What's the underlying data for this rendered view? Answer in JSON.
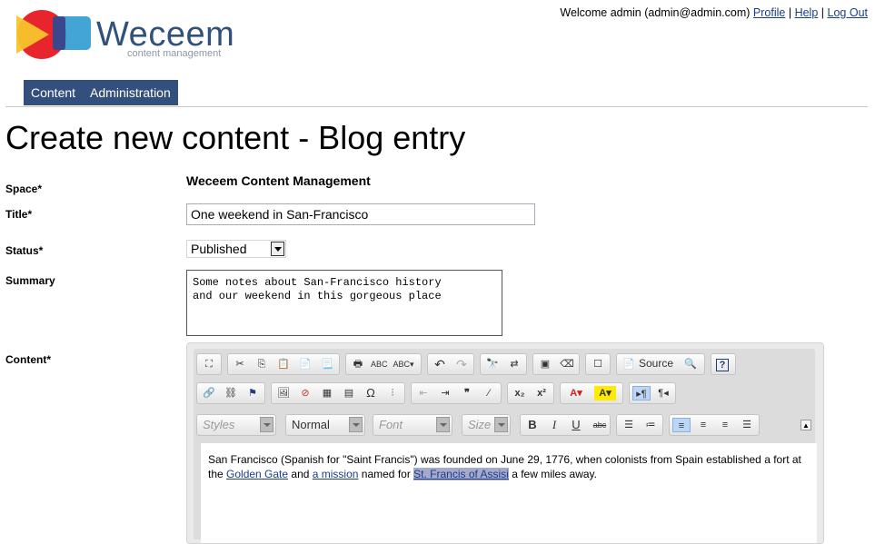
{
  "logo": {
    "name": "Weceem",
    "tagline": "content management"
  },
  "topbar": {
    "welcome": "Welcome admin (admin@admin.com)",
    "profile": "Profile",
    "help": "Help",
    "logout": "Log Out",
    "sep": "|"
  },
  "nav": {
    "tabs": [
      "Content",
      "Administration"
    ]
  },
  "page": {
    "title": "Create new content - Blog entry"
  },
  "form": {
    "space_label": "Space*",
    "space_value": "Weceem Content Management",
    "title_label": "Title*",
    "title_value": "One weekend in San-Francisco",
    "status_label": "Status*",
    "status_value": "Published",
    "summary_label": "Summary",
    "summary_value": "Some notes about San-Francisco history\nand our weekend in this gorgeous place",
    "content_label": "Content*"
  },
  "editor": {
    "source_label": "Source",
    "styles": "Styles",
    "format": "Normal",
    "font": "Font",
    "size": "Size",
    "text_1": "San Francisco (Spanish for \"Saint Francis\") was founded on June 29, 1776, when colonists from Spain established a fort at the ",
    "link_1": "Golden Gate",
    "text_2": " and ",
    "link_2": "a mission",
    "text_3": " named for ",
    "highlight": "St. Francis of Assisi",
    "text_4": " a few miles away."
  }
}
